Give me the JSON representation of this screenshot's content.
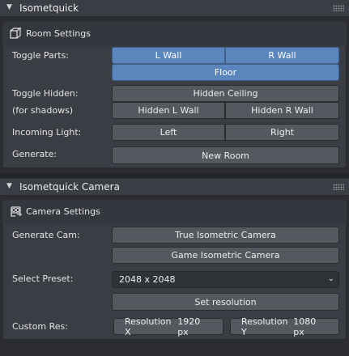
{
  "panel1": {
    "title": "Isometquick",
    "section_title": "Room Settings",
    "toggle_parts_label": "Toggle Parts:",
    "l_wall": "L Wall",
    "r_wall": "R Wall",
    "floor": "Floor",
    "toggle_hidden_label": "Toggle Hidden:",
    "for_shadows_label": "(for shadows)",
    "hidden_ceiling": "Hidden Ceiling",
    "hidden_l_wall": "Hidden L Wall",
    "hidden_r_wall": "Hidden R Wall",
    "incoming_light_label": "Incoming Light:",
    "left": "Left",
    "right": "Right",
    "generate_label": "Generate:",
    "new_room": "New Room"
  },
  "panel2": {
    "title": "Isometquick Camera",
    "section_title": "Camera Settings",
    "generate_cam_label": "Generate Cam:",
    "true_iso": "True Isometric Camera",
    "game_iso": "Game Isometric Camera",
    "select_preset_label": "Select Preset:",
    "preset_value": "2048 x 2048",
    "set_resolution": "Set resolution",
    "custom_res_label": "Custom Res:",
    "res_x_label": "Resolution X",
    "res_x_value": "1920 px",
    "res_y_label": "Resolution Y",
    "res_y_value": "1080 px"
  },
  "colors": {
    "background": "#2b2d32",
    "panel": "#3a3d43",
    "button": "#54585f",
    "toggle_on": "#5a86bd"
  }
}
